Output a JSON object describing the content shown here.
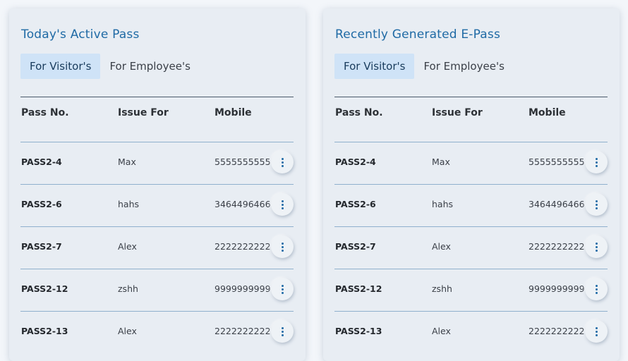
{
  "panels": [
    {
      "title": "Today's Active Pass",
      "tabs": [
        "For Visitor's",
        "For Employee's"
      ],
      "columns": [
        "Pass No.",
        "Issue For",
        "Mobile"
      ],
      "rows": [
        {
          "pass": "PASS2-4",
          "name": "Max",
          "mobile": "5555555555"
        },
        {
          "pass": "PASS2-6",
          "name": "hahs",
          "mobile": "3464496466"
        },
        {
          "pass": "PASS2-7",
          "name": "Alex",
          "mobile": "2222222222"
        },
        {
          "pass": "PASS2-12",
          "name": "zshh",
          "mobile": "9999999999"
        },
        {
          "pass": "PASS2-13",
          "name": "Alex",
          "mobile": "2222222222"
        }
      ]
    },
    {
      "title": "Recently Generated E-Pass",
      "tabs": [
        "For Visitor's",
        "For Employee's"
      ],
      "columns": [
        "Pass No.",
        "Issue For",
        "Mobile"
      ],
      "rows": [
        {
          "pass": "PASS2-4",
          "name": "Max",
          "mobile": "5555555555"
        },
        {
          "pass": "PASS2-6",
          "name": "hahs",
          "mobile": "3464496466"
        },
        {
          "pass": "PASS2-7",
          "name": "Alex",
          "mobile": "2222222222"
        },
        {
          "pass": "PASS2-12",
          "name": "zshh",
          "mobile": "9999999999"
        },
        {
          "pass": "PASS2-13",
          "name": "Alex",
          "mobile": "2222222222"
        }
      ]
    }
  ],
  "icons": {
    "row_action": "more-vertical-icon"
  },
  "colors": {
    "accent": "#1f6aa5",
    "active_tab": "#cfe3f7",
    "card": "#e8edf3"
  }
}
